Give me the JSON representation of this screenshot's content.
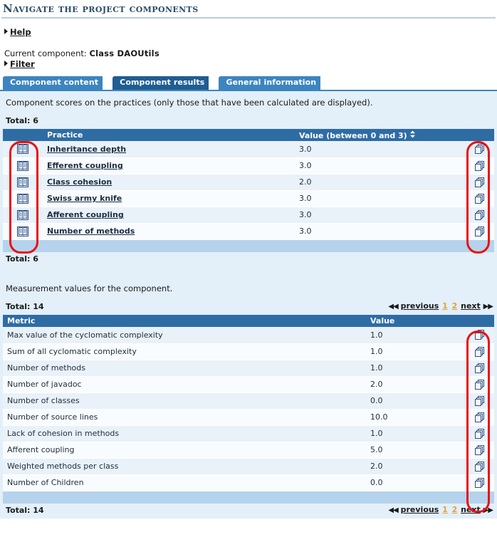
{
  "header": {
    "title": "Navigate the project components"
  },
  "toggles": {
    "help_label": "Help",
    "filter_label": "Filter"
  },
  "current_component": {
    "label": "Current component:",
    "value": "Class DAOUtils"
  },
  "tabs": [
    {
      "label": "Component content",
      "active": false
    },
    {
      "label": "Component results",
      "active": true
    },
    {
      "label": "General information",
      "active": false
    }
  ],
  "practices_section": {
    "note": "Component scores on the practices (only those that have been calculated are displayed).",
    "total_top": "Total: 6",
    "total_bottom": "Total: 6",
    "columns": {
      "icon": "",
      "practice": "Practice",
      "value": "Value (between 0 and 3)",
      "action": ""
    },
    "sort_icon": "sort-updown-icon",
    "row_icon": "book-icon",
    "action_icon": "copy-icon",
    "rows": [
      {
        "practice": "Inheritance depth",
        "value": "3.0"
      },
      {
        "practice": "Efferent coupling",
        "value": "3.0"
      },
      {
        "practice": "Class cohesion",
        "value": "2.0"
      },
      {
        "practice": "Swiss army knife",
        "value": "3.0"
      },
      {
        "practice": "Afferent coupling",
        "value": "3.0"
      },
      {
        "practice": "Number of methods",
        "value": "3.0"
      }
    ]
  },
  "metrics_section": {
    "note": "Measurement values for the component.",
    "total_top": "Total: 14",
    "total_bottom": "Total: 14",
    "columns": {
      "metric": "Metric",
      "value": "Value",
      "action": ""
    },
    "action_icon": "copy-icon",
    "pager": {
      "previous": "previous",
      "next": "next",
      "pages": [
        "1",
        "2"
      ],
      "current_page": "1",
      "prev_arrows": "◀◀",
      "next_arrows": "▶▶"
    },
    "rows": [
      {
        "metric": "Max value of the cyclomatic complexity",
        "value": "1.0"
      },
      {
        "metric": "Sum of all cyclomatic complexity",
        "value": "1.0"
      },
      {
        "metric": "Number of methods",
        "value": "1.0"
      },
      {
        "metric": "Number of javadoc",
        "value": "2.0"
      },
      {
        "metric": "Number of classes",
        "value": "0.0"
      },
      {
        "metric": "Number of source lines",
        "value": "10.0"
      },
      {
        "metric": "Lack of cohesion in methods",
        "value": "1.0"
      },
      {
        "metric": "Afferent coupling",
        "value": "5.0"
      },
      {
        "metric": "Weighted methods per class",
        "value": "2.0"
      },
      {
        "metric": "Number of Children",
        "value": "0.0"
      }
    ]
  },
  "annotations": [
    {
      "name": "annotation-practice-book-icons"
    },
    {
      "name": "annotation-practice-copy-icons"
    },
    {
      "name": "annotation-metric-copy-icons"
    }
  ],
  "colors": {
    "tab_active": "#1f5d92",
    "tab_inactive": "#3c85bf",
    "table_header": "#2e6ca4",
    "panel_bg": "#e3eff9",
    "footer_bar": "#b5d3ec",
    "annotation": "#e81010",
    "page_link": "#e0a23c"
  }
}
